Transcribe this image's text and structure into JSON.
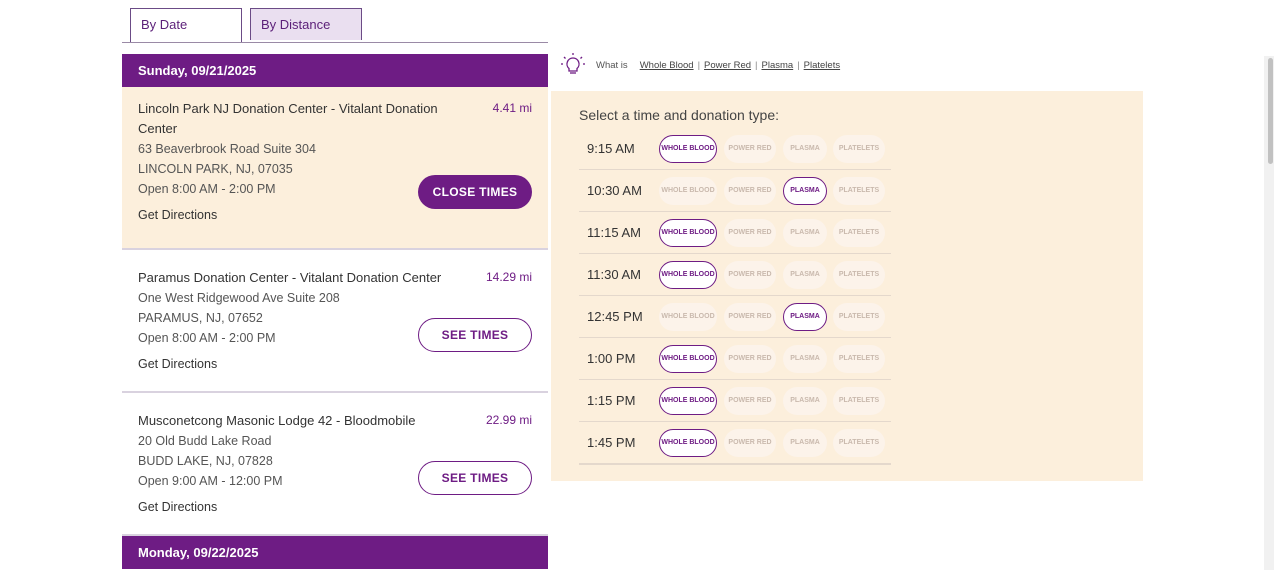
{
  "tabs": {
    "by_date": "By Date",
    "by_distance": "By Distance"
  },
  "dates": {
    "first": "Sunday, 09/21/2025",
    "second": "Monday, 09/22/2025"
  },
  "centers": [
    {
      "name": "Lincoln Park NJ Donation Center - Vitalant Donation Center",
      "distance": "4.41 mi",
      "address": "63 Beaverbrook Road Suite 304",
      "city": "LINCOLN PARK, NJ, 07035",
      "hours": "Open 8:00 AM - 2:00 PM",
      "directions": "Get Directions",
      "button": "CLOSE TIMES"
    },
    {
      "name": "Paramus Donation Center - Vitalant Donation Center",
      "distance": "14.29 mi",
      "address": "One West Ridgewood Ave Suite 208",
      "city": "PARAMUS, NJ, 07652",
      "hours": "Open 8:00 AM - 2:00 PM",
      "directions": "Get Directions",
      "button": "SEE TIMES"
    },
    {
      "name": "Musconetcong Masonic Lodge 42 - Bloodmobile",
      "distance": "22.99 mi",
      "address": "20 Old Budd Lake Road",
      "city": "BUDD LAKE, NJ, 07828",
      "hours": "Open 9:00 AM - 12:00 PM",
      "directions": "Get Directions",
      "button": "SEE TIMES"
    }
  ],
  "whatis": {
    "icon": "lightbulb-icon",
    "label": "What is",
    "links": [
      "Whole Blood",
      "Power Red",
      "Plasma",
      "Platelets"
    ]
  },
  "times_title": "Select a time and donation type:",
  "donation_labels": {
    "whole_blood": "WHOLE BLOOD",
    "power_red": "POWER RED",
    "plasma": "PLASMA",
    "platelets": "PLATELETS"
  },
  "slots": [
    {
      "time": "9:15 AM",
      "available": [
        "whole_blood"
      ]
    },
    {
      "time": "10:30 AM",
      "available": [
        "plasma"
      ]
    },
    {
      "time": "11:15 AM",
      "available": [
        "whole_blood"
      ]
    },
    {
      "time": "11:30 AM",
      "available": [
        "whole_blood"
      ]
    },
    {
      "time": "12:45 PM",
      "available": [
        "plasma"
      ]
    },
    {
      "time": "1:00 PM",
      "available": [
        "whole_blood"
      ]
    },
    {
      "time": "1:15 PM",
      "available": [
        "whole_blood"
      ]
    },
    {
      "time": "1:45 PM",
      "available": [
        "whole_blood"
      ]
    }
  ],
  "colors": {
    "accent": "#6e1c84",
    "selected_bg": "#fcefdc",
    "panel_bg": "#fcefdc"
  }
}
